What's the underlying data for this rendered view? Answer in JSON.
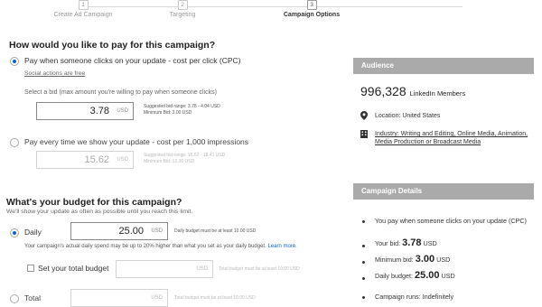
{
  "steps": [
    {
      "num": "1",
      "label": "Create Ad Campaign"
    },
    {
      "num": "2",
      "label": "Targeting"
    },
    {
      "num": "3",
      "label": "Campaign Options"
    }
  ],
  "payment": {
    "heading": "How would you like to pay for this campaign?",
    "cpc_label": "Pay when someone clicks on your update - cost per click (CPC)",
    "cpc_sub": "Social actions are free",
    "bid_label": "Select a bid (max amount you're willing to pay when someone clicks)",
    "cpc_bid_value": "3.78",
    "currency": "USD",
    "cpc_hint_range": "Suggested bid range: 3.78 - 4.04 USD",
    "cpc_hint_min": "Minimum Bid: 3.00 USD",
    "cpm_label": "Pay every time we show your update - cost per 1,000 impressions",
    "cpm_bid_value": "15.62",
    "cpm_hint_range": "Suggested bid range: 15.62 - 18.41 USD",
    "cpm_hint_min": "Minimum Bid: 12.30 USD"
  },
  "budget": {
    "heading": "What's your budget for this campaign?",
    "subheading": "We'll show your update as often as possible until you reach this limit.",
    "daily_label": "Daily",
    "daily_value": "25.00",
    "daily_hint": "Daily budget must be at least 10.00 USD",
    "daily_note": "Your campaign's actual daily spend may be up to 20% higher than what you set as your daily budget.",
    "learn_more": "Learn more.",
    "total_check_label": "Set your total budget",
    "total_hint": "Total budget must be at least 10.00 USD",
    "total_label": "Total",
    "total_hint2": "Total budget must be at least 10.00 USD"
  },
  "audience": {
    "title": "Audience",
    "count": "996,328",
    "count_label": "LinkedIn Members",
    "location": "Location: United States",
    "industry": "Industry: Writing and Editing, Online Media, Animation, Media Production or Broadcast Media"
  },
  "details": {
    "title": "Campaign Details",
    "pay_text": "You pay when someone clicks on your update (CPC)",
    "bid_prefix": "Your bid:",
    "bid_value": "3.78",
    "min_prefix": "Minimum bid:",
    "min_value": "3.00",
    "daily_prefix": "Daily budget:",
    "daily_value": "25.00",
    "currency": "USD",
    "runs": "Campaign runs: Indefinitely"
  },
  "colors": {
    "accent": "#0a66c2",
    "panel_header": "#aaaaaa"
  },
  "icons": {
    "location": "map-pin-icon",
    "industry": "building-icon"
  }
}
